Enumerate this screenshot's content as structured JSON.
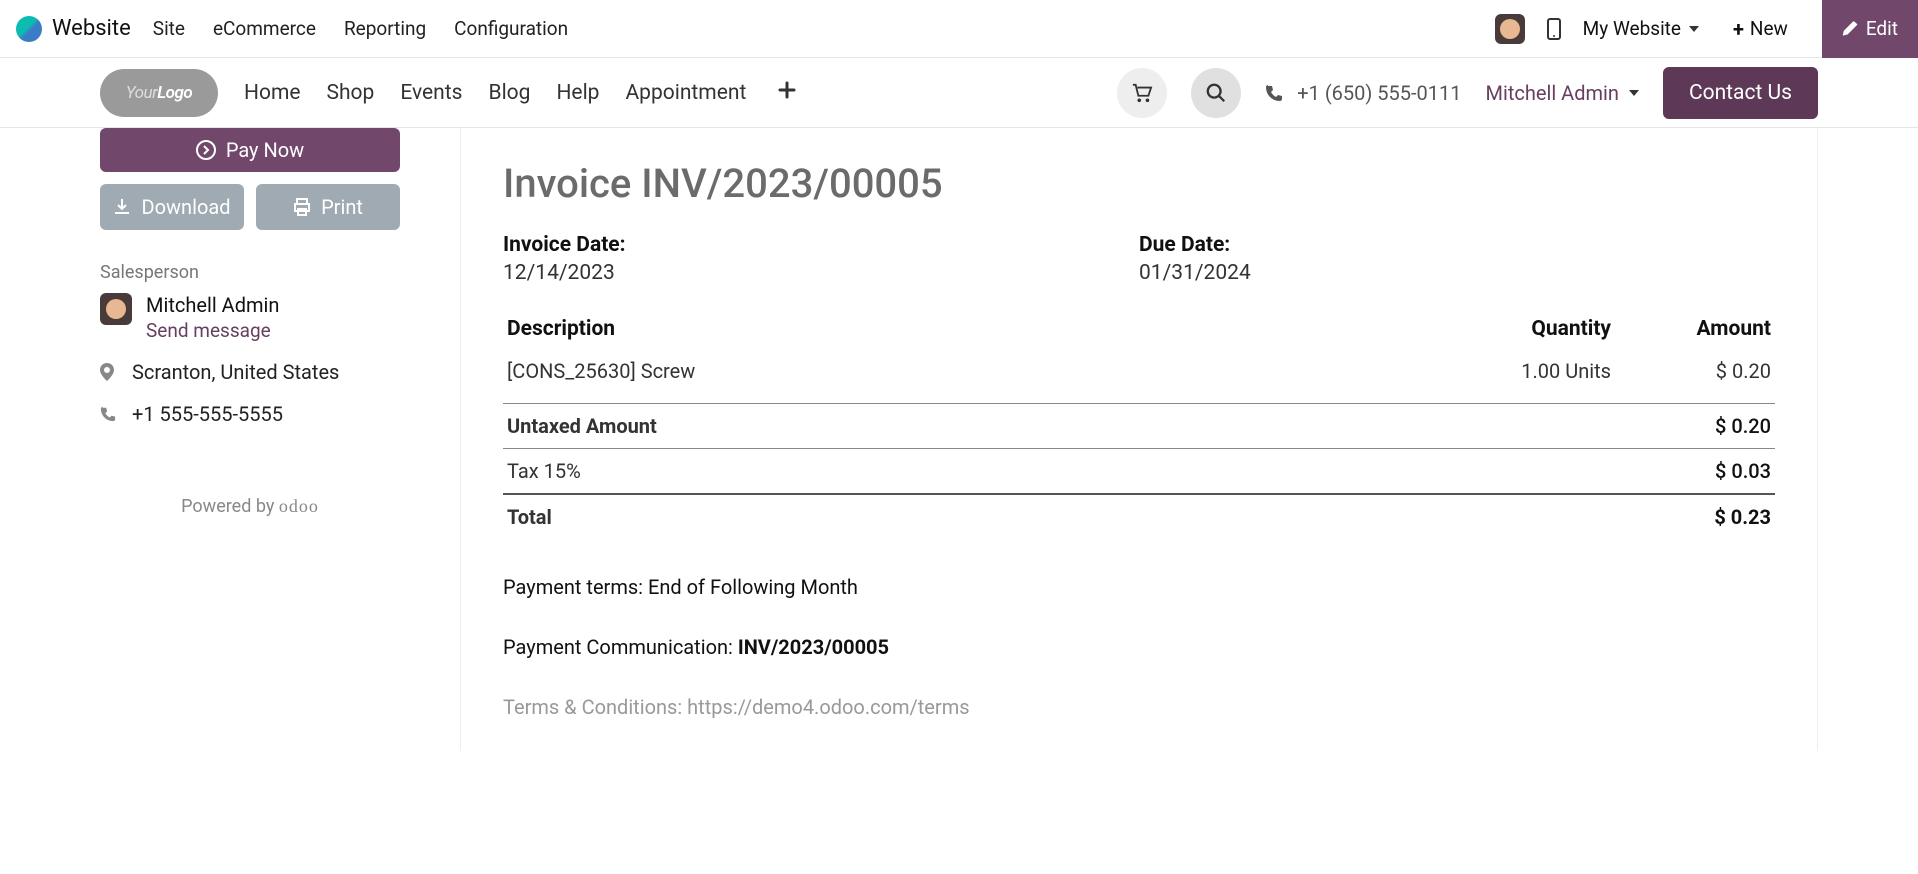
{
  "admin_bar": {
    "brand": "Website",
    "menu": [
      "Site",
      "eCommerce",
      "Reporting",
      "Configuration"
    ],
    "website_dropdown": "My Website",
    "new_btn": "New",
    "edit_btn": "Edit"
  },
  "site_header": {
    "nav": [
      "Home",
      "Shop",
      "Events",
      "Blog",
      "Help",
      "Appointment"
    ],
    "phone": "+1 (650) 555-0111",
    "user": "Mitchell Admin",
    "contact_btn": "Contact Us"
  },
  "sidebar": {
    "pay_now": "Pay Now",
    "download": "Download",
    "print": "Print",
    "salesperson_label": "Salesperson",
    "salesperson_name": "Mitchell Admin",
    "send_message": "Send message",
    "location": "Scranton, United States",
    "phone": "+1 555-555-5555",
    "powered_prefix": "Powered by ",
    "powered_brand": "odoo"
  },
  "invoice": {
    "title": "Invoice INV/2023/00005",
    "invoice_date_label": "Invoice Date:",
    "invoice_date": "12/14/2023",
    "due_date_label": "Due Date:",
    "due_date": "01/31/2024",
    "col_desc": "Description",
    "col_qty": "Quantity",
    "col_amt": "Amount",
    "line": {
      "desc": "[CONS_25630] Screw",
      "qty": "1.00 Units",
      "amt": "$ 0.20"
    },
    "untaxed_label": "Untaxed Amount",
    "untaxed_val": "$ 0.20",
    "tax_label": "Tax 15%",
    "tax_val": "$ 0.03",
    "total_label": "Total",
    "total_val": "$ 0.23",
    "payment_terms": "Payment terms: End of Following Month",
    "payment_comm_label": "Payment Communication: ",
    "payment_comm_value": "INV/2023/00005",
    "terms_text": "Terms & Conditions: https://demo4.odoo.com/terms"
  }
}
